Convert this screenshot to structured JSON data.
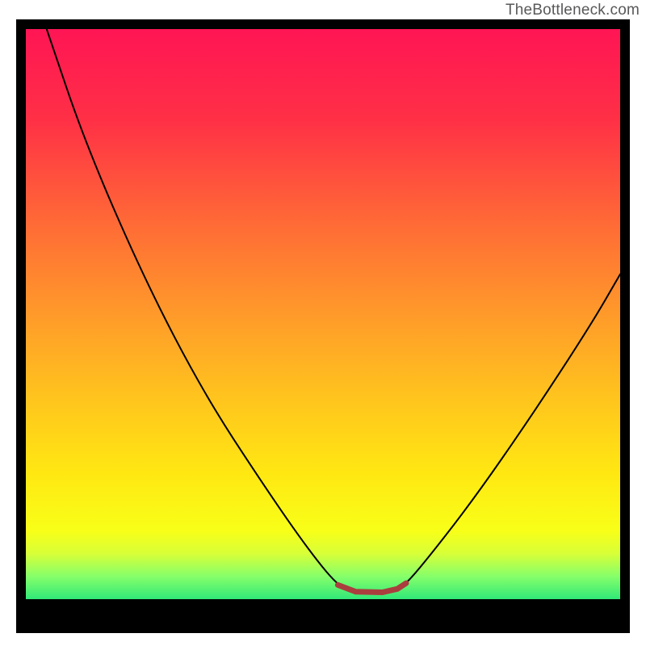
{
  "watermark": "TheBottleneck.com",
  "chart_data": {
    "type": "line",
    "title": "",
    "xlabel": "",
    "ylabel": "",
    "series": [
      {
        "name": "main-curve",
        "color": "#000000",
        "points": [
          {
            "x": 0.035,
            "y": 1.0
          },
          {
            "x": 0.1,
            "y": 0.8
          },
          {
            "x": 0.2,
            "y": 0.56
          },
          {
            "x": 0.3,
            "y": 0.36
          },
          {
            "x": 0.4,
            "y": 0.2
          },
          {
            "x": 0.48,
            "y": 0.08
          },
          {
            "x": 0.53,
            "y": 0.018
          },
          {
            "x": 0.56,
            "y": 0.012
          },
          {
            "x": 0.6,
            "y": 0.012
          },
          {
            "x": 0.63,
            "y": 0.018
          },
          {
            "x": 0.66,
            "y": 0.05
          },
          {
            "x": 0.75,
            "y": 0.17
          },
          {
            "x": 0.85,
            "y": 0.32
          },
          {
            "x": 0.95,
            "y": 0.48
          },
          {
            "x": 1.0,
            "y": 0.57
          }
        ]
      },
      {
        "name": "bottom-highlight",
        "color": "#aa3e3e",
        "points": [
          {
            "x": 0.525,
            "y": 0.025
          },
          {
            "x": 0.555,
            "y": 0.013
          },
          {
            "x": 0.6,
            "y": 0.012
          },
          {
            "x": 0.625,
            "y": 0.018
          },
          {
            "x": 0.64,
            "y": 0.028
          }
        ]
      }
    ],
    "gradient_stops": [
      {
        "offset": 0.0,
        "color": "#ff1554"
      },
      {
        "offset": 0.16,
        "color": "#ff3046"
      },
      {
        "offset": 0.34,
        "color": "#ff6a36"
      },
      {
        "offset": 0.5,
        "color": "#ff9a2a"
      },
      {
        "offset": 0.64,
        "color": "#ffc21e"
      },
      {
        "offset": 0.78,
        "color": "#ffe812"
      },
      {
        "offset": 0.88,
        "color": "#f8ff18"
      },
      {
        "offset": 0.92,
        "color": "#d8ff38"
      },
      {
        "offset": 0.96,
        "color": "#86ff6a"
      },
      {
        "offset": 1.0,
        "color": "#30e878"
      }
    ]
  }
}
